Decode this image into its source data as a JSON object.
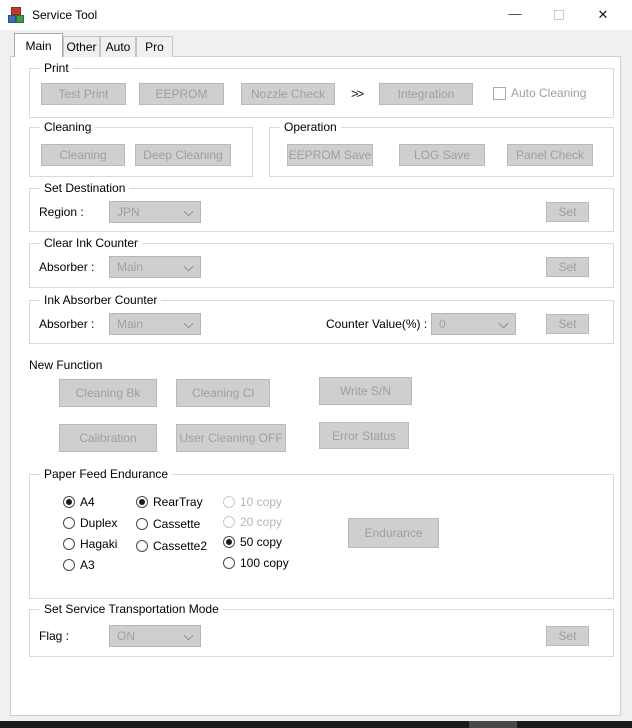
{
  "window": {
    "title": "Service Tool",
    "minimize_glyph": "—",
    "close_glyph": "✕"
  },
  "tabs": [
    {
      "label": "Main"
    },
    {
      "label": "Other"
    },
    {
      "label": "Auto"
    },
    {
      "label": "Pro"
    }
  ],
  "print": {
    "title": "Print",
    "test_print": "Test Print",
    "eeprom": "EEPROM",
    "nozzle_check": "Nozzle Check",
    "arrow": ">>",
    "integration": "Integration",
    "auto_cleaning": "Auto Cleaning"
  },
  "cleaning": {
    "title": "Cleaning",
    "cleaning": "Cleaning",
    "deep_cleaning": "Deep Cleaning"
  },
  "operation": {
    "title": "Operation",
    "eeprom_save": "EEPROM Save",
    "log_save": "LOG Save",
    "panel_check": "Panel Check"
  },
  "set_destination": {
    "title": "Set Destination",
    "label": "Region :",
    "value": "JPN",
    "set": "Set"
  },
  "clear_ink_counter": {
    "title": "Clear Ink Counter",
    "label": "Absorber :",
    "value": "Main",
    "set": "Set"
  },
  "ink_absorber_counter": {
    "title": "Ink Absorber Counter",
    "label": "Absorber :",
    "value": "Main",
    "counter_label": "Counter Value(%) :",
    "counter_value": "0",
    "set": "Set"
  },
  "new_function": {
    "title": "New Function",
    "cleaning_bk": "Cleaning Bk",
    "cleaning_cl": "Cleaning Cl",
    "write_sn": "Write S/N",
    "calibration": "Calibration",
    "user_cleaning_off": "User Cleaning OFF",
    "error_status": "Error Status"
  },
  "paper_feed": {
    "title": "Paper Feed Endurance",
    "sizes": [
      {
        "label": "A4",
        "checked": true
      },
      {
        "label": "Duplex",
        "checked": false
      },
      {
        "label": "Hagaki",
        "checked": false
      },
      {
        "label": "A3",
        "checked": false
      }
    ],
    "trays": [
      {
        "label": "RearTray",
        "checked": true
      },
      {
        "label": "Cassette",
        "checked": false
      },
      {
        "label": "Cassette2",
        "checked": false
      }
    ],
    "copies": [
      {
        "label": "10 copy",
        "checked": false,
        "disabled": true
      },
      {
        "label": "20 copy",
        "checked": false,
        "disabled": true
      },
      {
        "label": "50 copy",
        "checked": true,
        "disabled": false
      },
      {
        "label": "100 copy",
        "checked": false,
        "disabled": false
      }
    ],
    "endurance": "Endurance"
  },
  "transport_mode": {
    "title": "Set Service Transportation Mode",
    "label": "Flag :",
    "value": "ON",
    "set": "Set"
  },
  "colors": {
    "disabled_button_bg": "#cfcfcf",
    "disabled_text": "#9f9f9f",
    "taskbar": "#1b1b1b",
    "taskbar_segment": "#484848"
  }
}
